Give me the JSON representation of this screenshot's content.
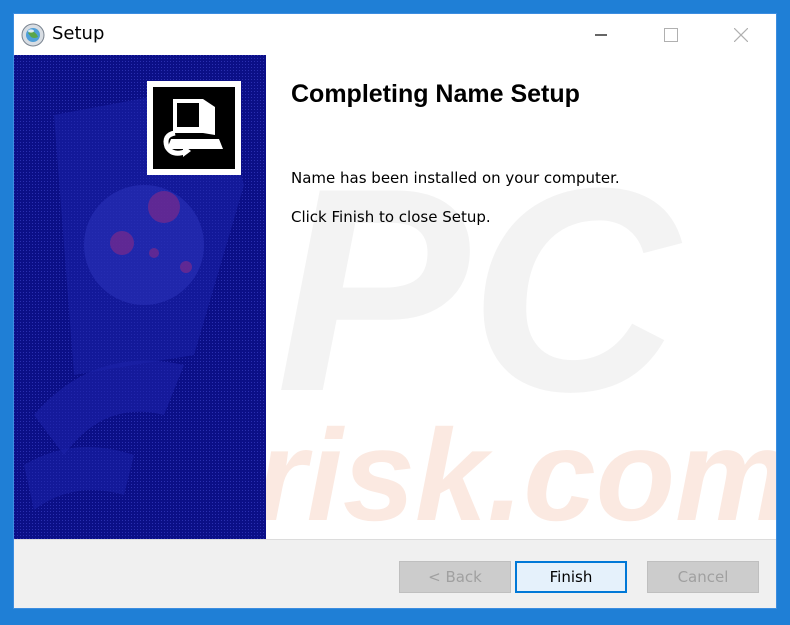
{
  "window": {
    "title": "Setup"
  },
  "content": {
    "heading": "Completing Name Setup",
    "line1": "Name has been installed on your computer.",
    "line2": "Click Finish to close Setup."
  },
  "buttons": {
    "back": "< Back",
    "finish": "Finish",
    "cancel": "Cancel"
  },
  "watermark": {
    "top": "PC",
    "bottom": "risk.com"
  },
  "colors": {
    "desktop": "#1f7fd6",
    "sidebar": "#0b0f87",
    "accent": "#0078d7"
  },
  "icons": {
    "app": "setup-globe-icon",
    "logo": "computer-install-icon"
  }
}
